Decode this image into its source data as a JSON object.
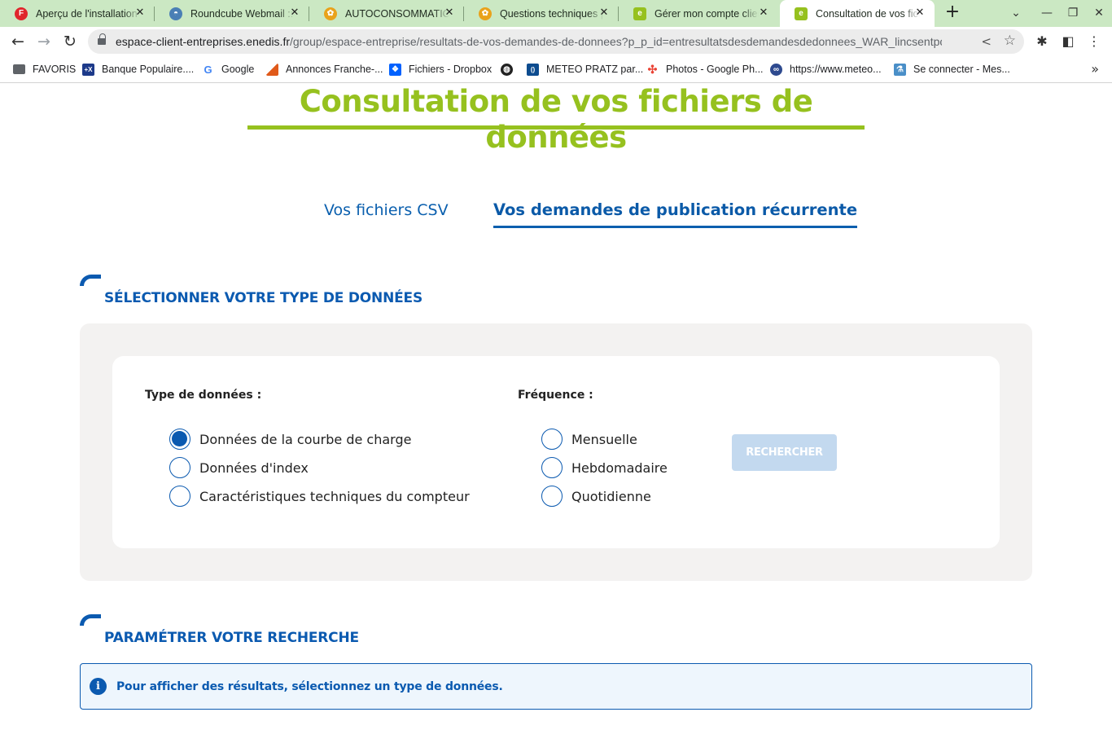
{
  "browser": {
    "tabs": [
      {
        "title": "Aperçu de l'installation",
        "favicon": "fire-logo-icon",
        "favicon_color": "#e0262c",
        "favicon_glyph": "F",
        "active": false
      },
      {
        "title": "Roundcube Webmail :: I",
        "favicon": "roundcube-icon",
        "favicon_color": "#4a7fb5",
        "favicon_glyph": "◓",
        "active": false
      },
      {
        "title": "AUTOCONSOMMATION",
        "favicon": "community-icon",
        "favicon_color": "#e9a21b",
        "favicon_glyph": "✿",
        "active": false
      },
      {
        "title": "Questions techniques |",
        "favicon": "community-icon",
        "favicon_color": "#e9a21b",
        "favicon_glyph": "✿",
        "active": false
      },
      {
        "title": "Gérer mon compte client",
        "favicon": "enedis-icon",
        "favicon_color": "#96c11f",
        "favicon_glyph": "e",
        "active": false
      },
      {
        "title": "Consultation de vos fichiers",
        "favicon": "enedis-icon",
        "favicon_color": "#96c11f",
        "favicon_glyph": "e",
        "active": true
      }
    ],
    "new_tab_glyph": "+",
    "tab_search_glyph": "⌄",
    "window_controls": {
      "minimize": "—",
      "restore": "❐",
      "close": "✕"
    },
    "nav": {
      "back": "←",
      "forward": "→",
      "reload": "↻"
    },
    "url": {
      "host": "espace-client-entreprises.enedis.fr",
      "path": "/group/espace-entreprise/resultats-de-vos-demandes-de-donnees?p_p_id=entresultatsdesdemandesdedonnees_WAR_lincsentportlet..."
    },
    "bookmarks": [
      {
        "label": "FAVORIS",
        "icon": "folder-icon",
        "color": "#5f6368",
        "glyph": ""
      },
      {
        "label": "Banque Populaire....",
        "icon": "banque-populaire-icon",
        "color": "#1d3a8a",
        "glyph": "+X"
      },
      {
        "label": "Google",
        "icon": "google-icon",
        "color": "#ffffff",
        "glyph": "G"
      },
      {
        "label": "Annonces Franche-...",
        "icon": "annonces-icon",
        "color": "#e05a1a",
        "glyph": ""
      },
      {
        "label": "Fichiers - Dropbox",
        "icon": "dropbox-icon",
        "color": "#0061fe",
        "glyph": "❖"
      },
      {
        "label": "",
        "icon": "globe-icon",
        "color": "#222222",
        "glyph": "◍"
      },
      {
        "label": "METEO PRATZ par...",
        "icon": "meteo-icon",
        "color": "#0d4c8f",
        "glyph": "()"
      },
      {
        "label": "Photos - Google Ph...",
        "icon": "google-photos-icon",
        "color": "#ffffff",
        "glyph": "✣"
      },
      {
        "label": "https://www.meteo...",
        "icon": "meteo-site-icon",
        "color": "#2e4a8f",
        "glyph": "∞"
      },
      {
        "label": "Se connecter - Mes...",
        "icon": "lab-icon",
        "color": "#4a8fc8",
        "glyph": "⚗"
      }
    ],
    "bookmarks_overflow": "»"
  },
  "page": {
    "title": "Consultation de vos fichiers de données",
    "tabs": [
      {
        "label": "Vos fichiers CSV",
        "active": false
      },
      {
        "label": "Vos demandes de publication récurrente",
        "active": true
      }
    ],
    "section_type": {
      "title": "SÉLECTIONNER VOTRE TYPE DE DONNÉES",
      "data_type_label": "Type de données :",
      "data_type_options": [
        {
          "label": "Données de la courbe de charge",
          "checked": true
        },
        {
          "label": "Données d'index",
          "checked": false
        },
        {
          "label": "Caractéristiques techniques du compteur",
          "checked": false
        }
      ],
      "frequency_label": "Fréquence :",
      "frequency_options": [
        {
          "label": "Mensuelle",
          "checked": false
        },
        {
          "label": "Hebdomadaire",
          "checked": false
        },
        {
          "label": "Quotidienne",
          "checked": false
        }
      ],
      "search_button": "RECHERCHER",
      "search_button_disabled": true
    },
    "section_search": {
      "title": "PARAMÉTRER VOTRE RECHERCHE",
      "info_glyph": "i",
      "info_message": "Pour afficher des résultats, sélectionnez un type de données."
    }
  },
  "colors": {
    "brand_green": "#96c11f",
    "brand_blue": "#0b5ab0",
    "panel_grey": "#f3f2f1",
    "button_disabled": "#c3d9ef",
    "info_bg": "#eef6fd",
    "tabbar_green": "#cbe8c3"
  }
}
